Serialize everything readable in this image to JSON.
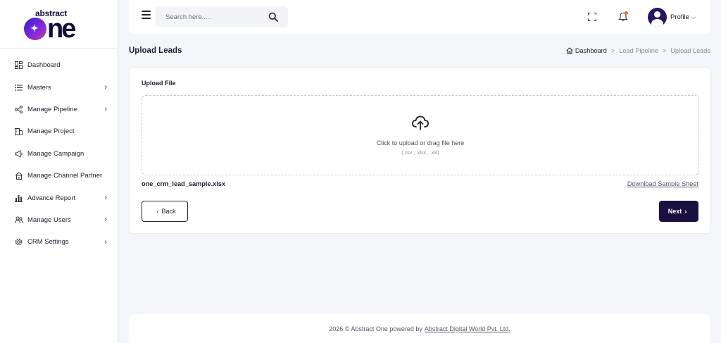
{
  "brand": {
    "small": "abstract",
    "big": "ne"
  },
  "sidebar": {
    "items": [
      {
        "label": "Dashboard",
        "icon": "dashboard-icon",
        "has_children": false
      },
      {
        "label": "Masters",
        "icon": "list-icon",
        "has_children": true
      },
      {
        "label": "Manage Pipeline",
        "icon": "pipeline-icon",
        "has_children": true
      },
      {
        "label": "Manage Project",
        "icon": "building-icon",
        "has_children": false
      },
      {
        "label": "Manage Campaign",
        "icon": "megaphone-icon",
        "has_children": false
      },
      {
        "label": "Manage Channel Partner",
        "icon": "partner-icon",
        "has_children": false
      },
      {
        "label": "Advance Report",
        "icon": "bar-chart-icon",
        "has_children": true
      },
      {
        "label": "Manage Users",
        "icon": "users-icon",
        "has_children": true
      },
      {
        "label": "CRM Settings",
        "icon": "gear-icon",
        "has_children": true
      }
    ]
  },
  "header": {
    "search_placeholder": "Search here.....",
    "profile_label": "Profile"
  },
  "page": {
    "title": "Upload Leads",
    "breadcrumb": {
      "home": "Dashboard",
      "middle": "Lead Pipeline",
      "current": "Upload Leads",
      "separator": ">"
    }
  },
  "upload": {
    "label": "Upload File",
    "drop_text": "Click to upload or drag file here",
    "drop_sub": "(.csv , .xlsx , .xls)",
    "file_name": "one_crm_lead_sample.xlsx",
    "sample_link": "Download Sample Sheet",
    "back_label": "Back",
    "next_label": "Next"
  },
  "footer": {
    "text": "2026 © Abstract One powered by",
    "link": "Abstract Digital World Pvt. Ltd."
  },
  "colors": {
    "primary": "#1a1040",
    "background": "#f4f5f8",
    "notification": "#f06a3a"
  }
}
